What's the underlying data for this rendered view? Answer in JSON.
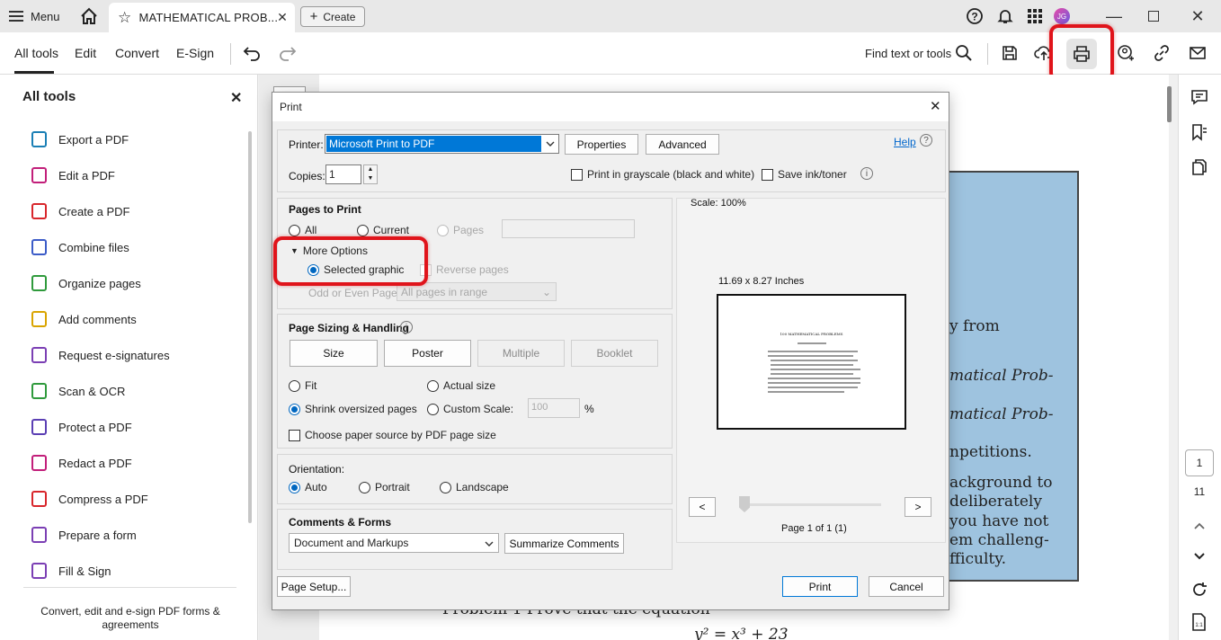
{
  "titlebar": {
    "menu_label": "Menu",
    "doc_tab": "MATHEMATICAL PROB...",
    "create_label": "Create",
    "avatar_initials": "JG"
  },
  "toolbar": {
    "tabs": [
      "All tools",
      "Edit",
      "Convert",
      "E-Sign"
    ],
    "find_text": "Find text or tools"
  },
  "sidebar": {
    "title": "All tools",
    "items": [
      {
        "label": "Export a PDF",
        "color": "#1a7fb5"
      },
      {
        "label": "Edit a PDF",
        "color": "#c21f7a"
      },
      {
        "label": "Create a PDF",
        "color": "#d8262b"
      },
      {
        "label": "Combine files",
        "color": "#3c5cc8"
      },
      {
        "label": "Organize pages",
        "color": "#2f9a3c"
      },
      {
        "label": "Add comments",
        "color": "#d9a400"
      },
      {
        "label": "Request e-signatures",
        "color": "#7b3fb4"
      },
      {
        "label": "Scan & OCR",
        "color": "#2f9a3c"
      },
      {
        "label": "Protect a PDF",
        "color": "#5b3fb4"
      },
      {
        "label": "Redact a PDF",
        "color": "#c21f7a"
      },
      {
        "label": "Compress a PDF",
        "color": "#d8262b"
      },
      {
        "label": "Prepare a form",
        "color": "#7b3fb4"
      },
      {
        "label": "Fill & Sign",
        "color": "#7b3fb4"
      }
    ],
    "footer": "Convert, edit and e-sign PDF forms & agreements"
  },
  "document": {
    "lines_right": [
      "y from",
      "matical Prob-",
      "matical Prob-",
      "npetitions.",
      "ackground to",
      "deliberately",
      "you have not",
      "em challeng-",
      "fficulty."
    ],
    "problem_line": "Problem 1   Prove that the equation",
    "equation": "y² = x³ + 23"
  },
  "right_rail": {
    "page_current": "1",
    "page_total": "11"
  },
  "print_dialog": {
    "title": "Print",
    "printer_label": "Printer:",
    "printer_value": "Microsoft Print to PDF",
    "properties_btn": "Properties",
    "advanced_btn": "Advanced",
    "help_link": "Help",
    "copies_label": "Copies:",
    "copies_value": "1",
    "grayscale_label": "Print in grayscale (black and white)",
    "save_ink_label": "Save ink/toner",
    "pages_to_print": {
      "heading": "Pages to Print",
      "all": "All",
      "current": "Current",
      "pages": "Pages",
      "more_options": "More Options",
      "selected_graphic": "Selected graphic",
      "reverse_pages": "Reverse pages",
      "odd_even_label": "Odd or Even Pages:",
      "odd_even_value": "All pages in range"
    },
    "sizing": {
      "heading": "Page Sizing & Handling",
      "size": "Size",
      "poster": "Poster",
      "multiple": "Multiple",
      "booklet": "Booklet",
      "fit": "Fit",
      "actual_size": "Actual size",
      "shrink": "Shrink oversized pages",
      "custom_scale": "Custom Scale:",
      "custom_scale_value": "100",
      "percent": "%",
      "paper_source": "Choose paper source by PDF page size"
    },
    "orientation": {
      "heading": "Orientation:",
      "auto": "Auto",
      "portrait": "Portrait",
      "landscape": "Landscape"
    },
    "comments_forms": {
      "heading": "Comments & Forms",
      "value": "Document and Markups",
      "summarize_btn": "Summarize Comments"
    },
    "preview": {
      "scale": "Scale: 100%",
      "paper_size": "11.69 x 8.27 Inches",
      "preview_title": "100 MATHEMATICAL PROBLEMS",
      "prev": "<",
      "next": ">",
      "page_info": "Page 1 of 1 (1)"
    },
    "page_setup_btn": "Page Setup...",
    "print_btn": "Print",
    "cancel_btn": "Cancel"
  }
}
